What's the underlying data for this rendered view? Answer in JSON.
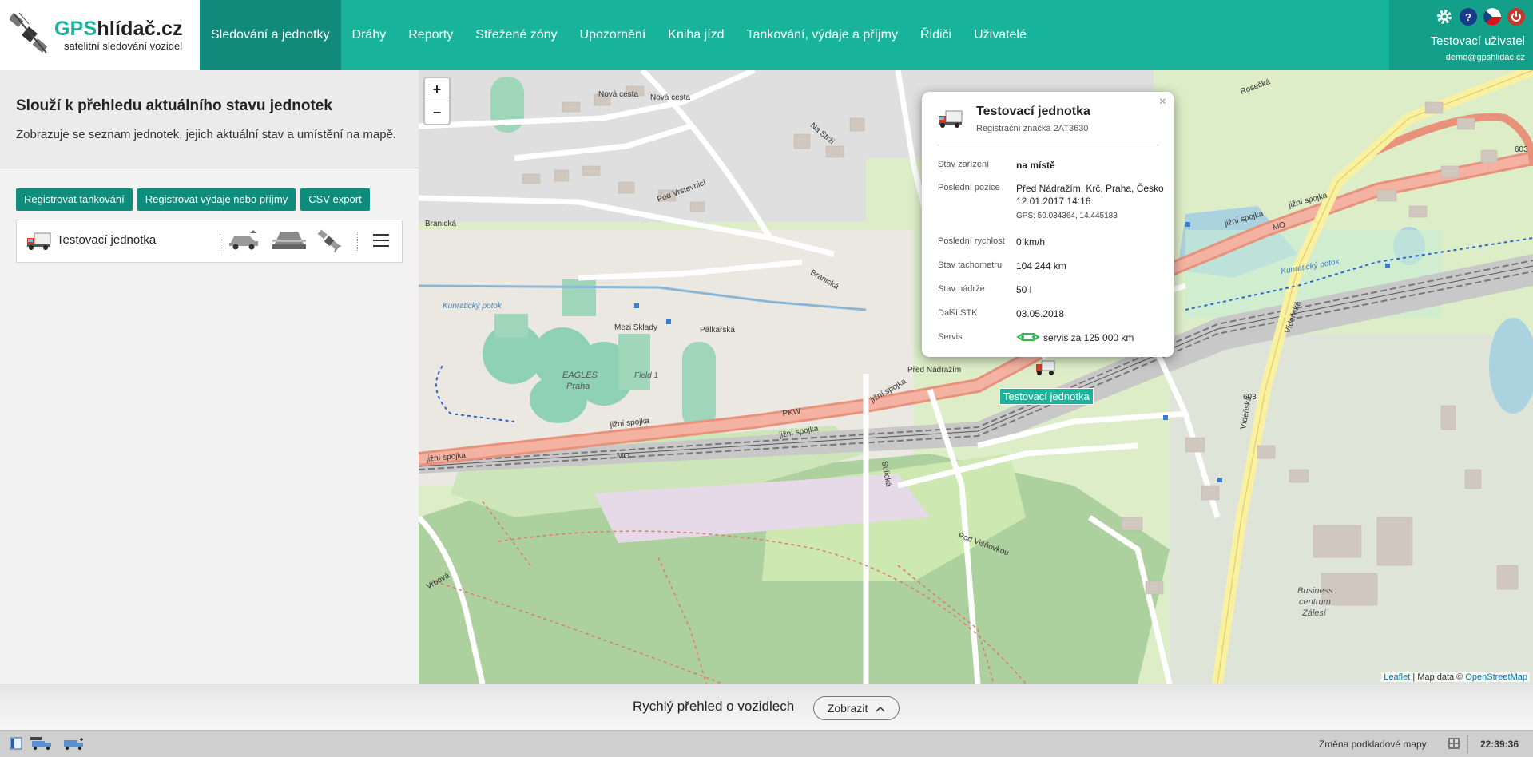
{
  "logo": {
    "gps": "GPS",
    "rest": "hlídač.cz",
    "subtitle": "satelitní sledování vozidel"
  },
  "nav": [
    {
      "label": "Sledování a jednotky",
      "active": true
    },
    {
      "label": "Dráhy"
    },
    {
      "label": "Reporty"
    },
    {
      "label": "Střežené zóny"
    },
    {
      "label": "Upozornění"
    },
    {
      "label": "Kniha jízd"
    },
    {
      "label": "Tankování, výdaje a příjmy"
    },
    {
      "label": "Řidiči"
    },
    {
      "label": "Uživatelé"
    }
  ],
  "user": {
    "name": "Testovací uživatel",
    "email": "demo@gpshlidac.cz",
    "help": "?"
  },
  "intro": {
    "title": "Slouží k přehledu aktuálního stavu jednotek",
    "text": "Zobrazuje se seznam jednotek, jejich aktuální stav a umístění na mapě."
  },
  "buttons": {
    "refuel": "Registrovat tankování",
    "expenses": "Registrovat výdaje nebo příjmy",
    "csv": "CSV export"
  },
  "unit": {
    "name": "Testovací jednotka"
  },
  "map": {
    "zoom_in": "+",
    "zoom_out": "−",
    "marker_label": "Testovací jednotka",
    "attribution_leaflet": "Leaflet",
    "attribution_text": " | Map data © ",
    "attribution_osm": "OpenStreetMap",
    "labels": {
      "jizni_spojka": "jižní spojka",
      "mo": "MO",
      "branicka": "Branická",
      "nova_cesta": "Nová cesta",
      "mezi_sklady": "Mezi Sklady",
      "palkarska": "Pálkařská",
      "kunraticky": "Kunratický potok",
      "eagles": "EAGLES",
      "praha": "Praha",
      "field": "Field 1",
      "business": "Business",
      "centrum": "centrum",
      "zalesi": "Zálesí",
      "videnska": "Vídeňská",
      "r603": "603",
      "sulicka": "Sulická",
      "pod_visnovkou": "Pod Višňovkou",
      "vrbova": "Vrbová",
      "rosecka": "Rosečká",
      "pod_vrstevnici": "Pod Vrstevnicí",
      "na_strzi": "Na Strži",
      "pred_nadrazim": "Před Nádražím",
      "pkw": "PKW"
    }
  },
  "popup": {
    "title": "Testovací jednotka",
    "reg": "Registrační značka 2AT3630",
    "rows": [
      {
        "label": "Stav zařízení",
        "value": "na místě"
      },
      {
        "label": "Poslední pozice",
        "value": "Před Nádražím, Krč, Praha, Česko",
        "value2": "12.01.2017 14:16",
        "value3": "GPS: 50.034364, 14.445183"
      },
      {
        "label": "Poslední rychlost",
        "value": "0 km/h"
      },
      {
        "label": "Stav tachometru",
        "value": "104 244 km"
      },
      {
        "label": "Stav nádrže",
        "value": "50 l"
      },
      {
        "label": "Další STK",
        "value": "03.05.2018"
      },
      {
        "label": "Servis",
        "value": "servis za 125 000 km"
      }
    ]
  },
  "quick": {
    "title": "Rychlý přehled o vozidlech",
    "button": "Zobrazit"
  },
  "status": {
    "map_label": "Změna podkladové mapy:",
    "time": "22:39:36"
  }
}
